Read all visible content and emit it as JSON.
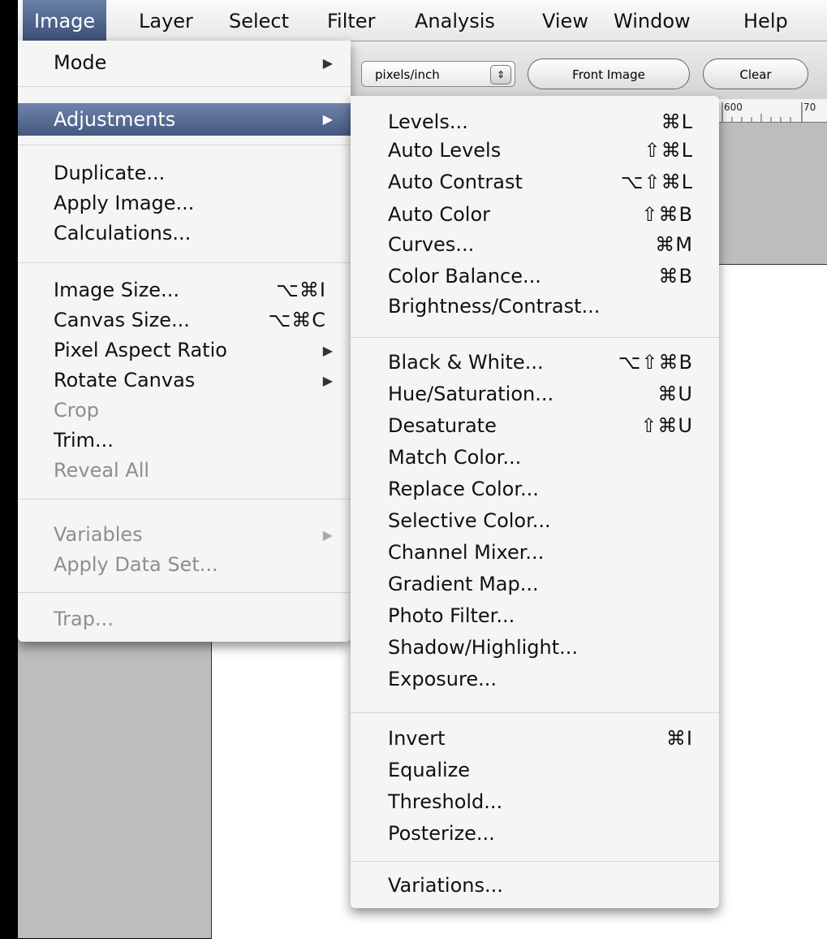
{
  "menubar": {
    "items": [
      "Image",
      "Layer",
      "Select",
      "Filter",
      "Analysis",
      "View",
      "Window",
      "Help"
    ]
  },
  "options_bar": {
    "units_select": "pixels/inch",
    "front_image_button": "Front Image",
    "clear_button": "Clear"
  },
  "ruler": {
    "label_600": "600",
    "label_700": "70"
  },
  "image_menu": {
    "items": [
      {
        "label": "Mode",
        "submenu": true
      },
      {
        "label": "Adjustments",
        "submenu": true,
        "highlighted": true
      },
      {
        "label": "Duplicate..."
      },
      {
        "label": "Apply Image..."
      },
      {
        "label": "Calculations..."
      },
      {
        "label": "Image Size...",
        "shortcut": "⌥⌘I"
      },
      {
        "label": "Canvas Size...",
        "shortcut": "⌥⌘C"
      },
      {
        "label": "Pixel Aspect Ratio",
        "submenu": true
      },
      {
        "label": "Rotate Canvas",
        "submenu": true
      },
      {
        "label": "Crop",
        "disabled": true
      },
      {
        "label": "Trim..."
      },
      {
        "label": "Reveal All",
        "disabled": true
      },
      {
        "label": "Variables",
        "submenu": true,
        "disabled": true
      },
      {
        "label": "Apply Data Set...",
        "disabled": true
      },
      {
        "label": "Trap...",
        "disabled": true
      }
    ]
  },
  "adjustments_menu": {
    "items": [
      {
        "label": "Levels...",
        "shortcut": "⌘L"
      },
      {
        "label": "Auto Levels",
        "shortcut": "⇧⌘L"
      },
      {
        "label": "Auto Contrast",
        "shortcut": "⌥⇧⌘L"
      },
      {
        "label": "Auto Color",
        "shortcut": "⇧⌘B"
      },
      {
        "label": "Curves...",
        "shortcut": "⌘M"
      },
      {
        "label": "Color Balance...",
        "shortcut": "⌘B"
      },
      {
        "label": "Brightness/Contrast..."
      },
      {
        "label": "Black & White...",
        "shortcut": "⌥⇧⌘B"
      },
      {
        "label": "Hue/Saturation...",
        "shortcut": "⌘U"
      },
      {
        "label": "Desaturate",
        "shortcut": "⇧⌘U"
      },
      {
        "label": "Match Color..."
      },
      {
        "label": "Replace Color..."
      },
      {
        "label": "Selective Color..."
      },
      {
        "label": "Channel Mixer..."
      },
      {
        "label": "Gradient Map..."
      },
      {
        "label": "Photo Filter..."
      },
      {
        "label": "Shadow/Highlight..."
      },
      {
        "label": "Exposure..."
      },
      {
        "label": "Invert",
        "shortcut": "⌘I"
      },
      {
        "label": "Equalize"
      },
      {
        "label": "Threshold..."
      },
      {
        "label": "Posterize..."
      },
      {
        "label": "Variations..."
      }
    ]
  }
}
